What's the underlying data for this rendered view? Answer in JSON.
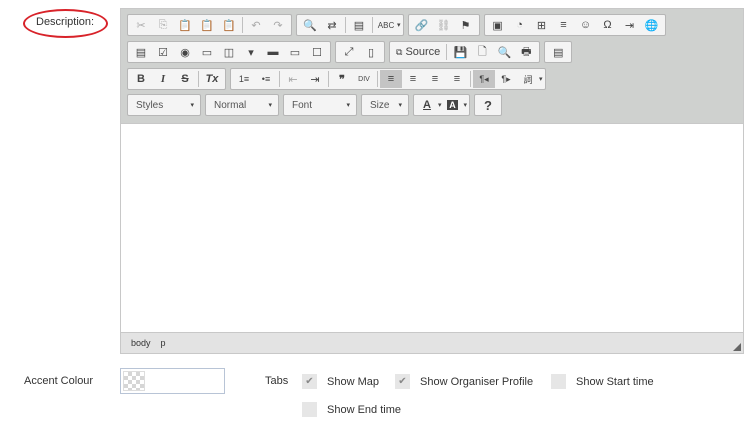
{
  "description": {
    "label": "Description:"
  },
  "editor": {
    "row1": {
      "g1": [
        "✂",
        "⎘",
        "📋",
        "📋",
        "📋"
      ],
      "g2": [
        "↶",
        "↷"
      ],
      "g3": [
        "🔍",
        "⇄",
        "▤",
        "ABC"
      ],
      "g4": [
        "🔗",
        "⛓",
        "⚑"
      ],
      "g5": [
        "▣",
        "◔",
        "⊞",
        "≡",
        "☺",
        "Ω",
        "⇥",
        "🌐"
      ]
    },
    "row2": {
      "g1": [
        "▤",
        "☑",
        "◉",
        "▭",
        "◫",
        "▾",
        "▬",
        "▭",
        "☐"
      ],
      "g2": [
        "⤢",
        "▯"
      ],
      "source_label": "Source",
      "g3": [
        "💾",
        "🗋",
        "🔍",
        "🖶"
      ],
      "g4": [
        "▤"
      ]
    },
    "row3": {
      "g1": [
        "B",
        "I",
        "S",
        "Tx"
      ],
      "g2": [
        "1≡",
        "•≡",
        "⇤",
        "⇥",
        "❞",
        "DIV"
      ],
      "g3": [
        "≡",
        "≡",
        "≡",
        "≡",
        "¶◂",
        "¶▸",
        "詞"
      ]
    },
    "row4": {
      "styles": "Styles",
      "format": "Normal",
      "font": "Font",
      "size": "Size",
      "text_color": "A",
      "bg_color": "A",
      "help": "?"
    },
    "status": [
      "body",
      "p"
    ]
  },
  "accent": {
    "label": "Accent Colour"
  },
  "tabs": {
    "label": "Tabs",
    "options": [
      {
        "label": "Show Map",
        "checked": true
      },
      {
        "label": "Show Organiser Profile",
        "checked": true
      },
      {
        "label": "Show Start time",
        "checked": false
      },
      {
        "label": "Show End time",
        "checked": false
      }
    ]
  }
}
